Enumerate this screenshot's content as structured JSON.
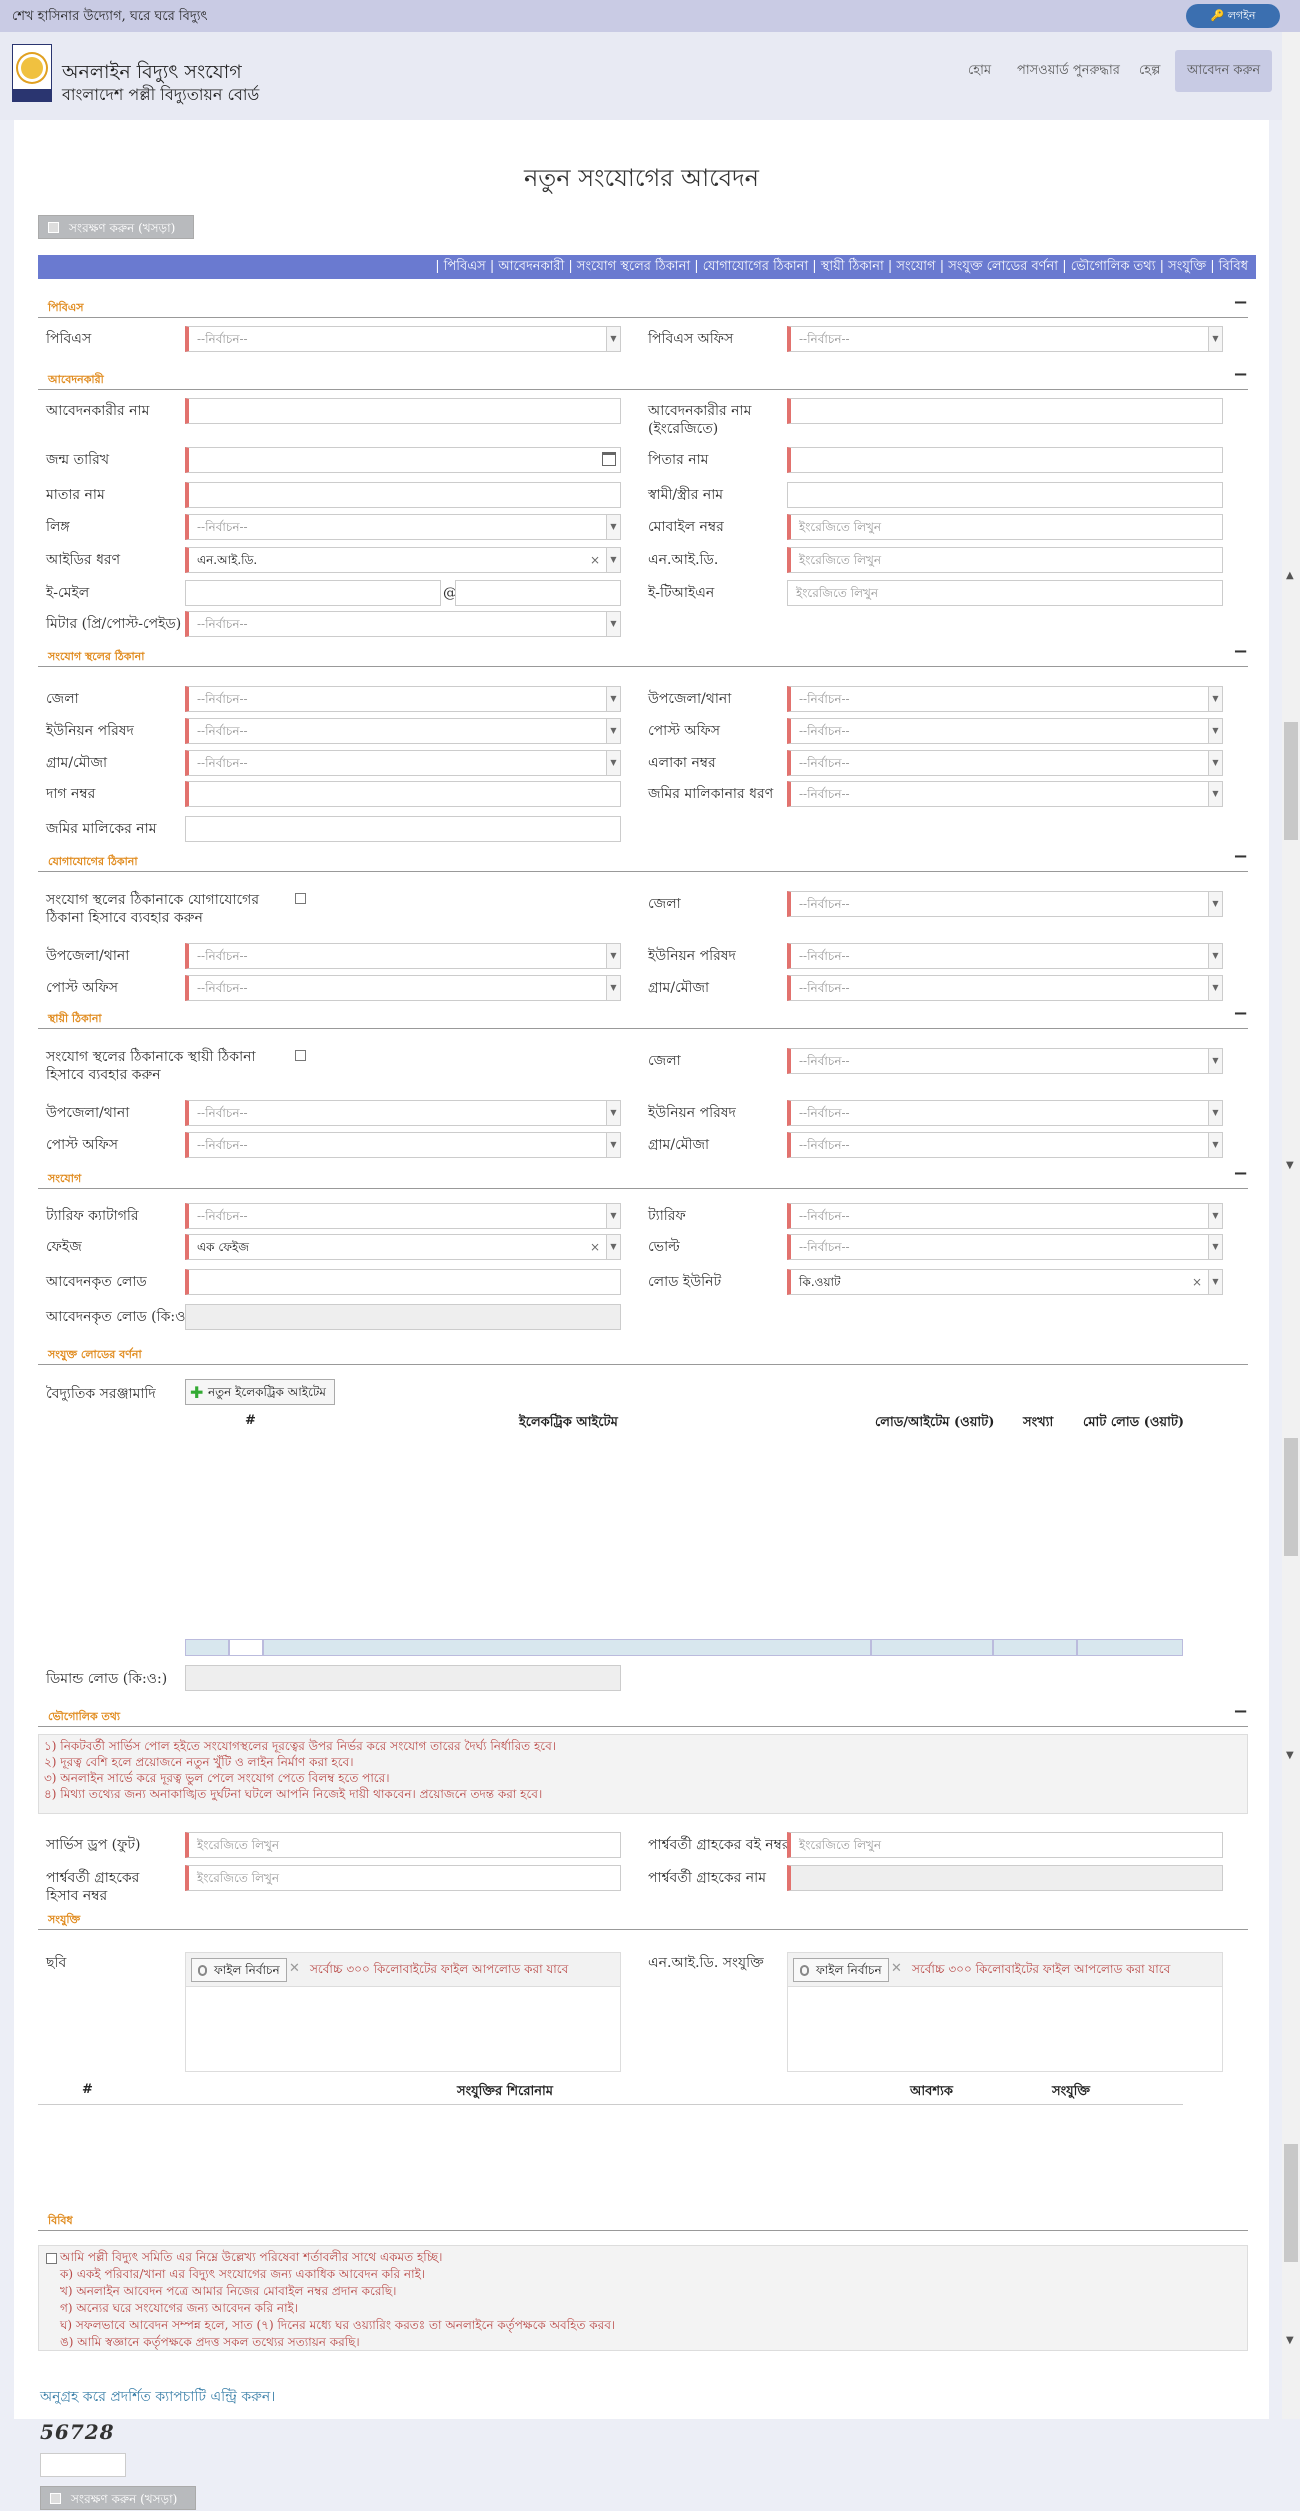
{
  "topbar": {
    "slogan": "শেখ হাসিনার উদ্যোগ, ঘরে ঘরে বিদ্যুৎ",
    "login": "🔑 লগইন"
  },
  "header": {
    "title": "অনলাইন বিদ্যুৎ সংযোগ",
    "subtitle": "বাংলাদেশ পল্লী বিদ্যুতায়ন বোর্ড",
    "nav": [
      "হোম",
      "পাসওয়ার্ড পুনরুদ্ধার",
      "হেল্প",
      "আবেদন করুন"
    ]
  },
  "page": {
    "title": "নতুন সংযোগের আবেদন",
    "save_label": "সংরক্ষণ করুন (খসড়া)",
    "tabs": "| পিবিএস | আবেদনকারী | সংযোগ স্থলের ঠিকানা | যোগাযোগের ঠিকানা | স্থায়ী ঠিকানা | সংযোগ | সংযুক্ত লোডের বর্ণনা | ভৌগোলিক তথ্য | সংযুক্তি | বিবিধ"
  },
  "placeholders": {
    "select": "--নির্বাচন--",
    "english": "ইংরেজিতে লিখুন"
  },
  "sections": {
    "pbs": {
      "title": "পিবিএস",
      "pbs": "পিবিএস",
      "office": "পিবিএস অফিস"
    },
    "applicant": {
      "title": "আবেদনকারী",
      "name": "আবেদনকারীর নাম",
      "name_en": "আবেদনকারীর নাম (ইংরেজিতে)",
      "dob": "জন্ম তারিখ",
      "father": "পিতার নাম",
      "mother": "মাতার নাম",
      "spouse": "স্বামী/স্ত্রীর নাম",
      "gender": "লিঙ্গ",
      "mobile": "মোবাইল নম্বর",
      "id_type": "আইডির ধরণ",
      "id_type_value": "এন.আই.ডি.",
      "nid": "এন.আই.ডি.",
      "email": "ই-মেইল",
      "email_at": "@",
      "tin": "ই-টিআইএন",
      "meter": "মিটার (প্রি/পোস্ট-পেইড)"
    },
    "conn_addr": {
      "title": "সংযোগ স্থলের ঠিকানা",
      "district": "জেলা",
      "upazila": "উপজেলা/থানা",
      "union": "ইউনিয়ন পরিষদ",
      "post": "পোস্ট অফিস",
      "village": "গ্রাম/মৌজা",
      "area": "এলাকা নম্বর",
      "dag": "দাগ নম্বর",
      "ownership": "জমির মালিকানার ধরণ",
      "owner": "জমির মালিকের নাম"
    },
    "contact_addr": {
      "title": "যোগাযোগের ঠিকানা",
      "same": "সংযোগ স্থলের ঠিকানাকে যোগাযোগের ঠিকানা হিসাবে ব্যবহার করুন",
      "district": "জেলা",
      "upazila": "উপজেলা/থানা",
      "union": "ইউনিয়ন পরিষদ",
      "post": "পোস্ট অফিস",
      "village": "গ্রাম/মৌজা"
    },
    "perm_addr": {
      "title": "স্থায়ী ঠিকানা",
      "same": "সংযোগ স্থলের ঠিকানাকে স্থায়ী ঠিকানা হিসাবে ব্যবহার করুন",
      "district": "জেলা",
      "upazila": "উপজেলা/থানা",
      "union": "ইউনিয়ন পরিষদ",
      "post": "পোস্ট অফিস",
      "village": "গ্রাম/মৌজা"
    },
    "connection": {
      "title": "সংযোগ",
      "tariff_cat": "ট্যারিফ ক্যাটাগরি",
      "tariff": "ট্যারিফ",
      "phase": "ফেইজ",
      "phase_value": "এক ফেইজ",
      "volt": "ভোল্ট",
      "load": "আবেদনকৃত লোড",
      "load_unit": "লোড ইউনিট",
      "load_unit_value": "কি.ওয়াট",
      "load_kw": "আবেদনকৃত লোড (কি:ও:)"
    },
    "load_desc": {
      "title": "সংযুক্ত লোডের বর্ণনা",
      "equipment": "বৈদ্যুতিক সরঞ্জামাদি",
      "add_item": "নতুন ইলেকট্রিক আইটেম",
      "columns": [
        "#",
        "ইলেকট্রিক আইটেম",
        "লোড/আইটেম (ওয়াট)",
        "সংখ্যা",
        "মোট লোড (ওয়াট)"
      ],
      "demand": "ডিমান্ড লোড (কি:ও:)"
    },
    "geo": {
      "title": "ভৌগোলিক তথ্য",
      "notes": [
        "১) নিকটবর্তী সার্ভিস পোল হইতে সংযোগস্থলের দূরত্বের উপর নির্ভর করে সংযোগ তারের দৈর্ঘ্য নির্ধারিত হবে।",
        "২) দূরত্ব বেশি হলে প্রয়োজনে নতুন খুঁটি ও লাইন নির্মাণ করা হবে।",
        "৩) অনলাইন সার্ভে করে দূরত্ব ভুল পেলে সংযোগ পেতে বিলম্ব হতে পারে।",
        "৪) মিথ্যা তথ্যের জন্য অনাকাঙ্খিত দুর্ঘটনা ঘটলে আপনি নিজেই দায়ী থাকবেন। প্রয়োজনে তদন্ত করা হবে।"
      ],
      "service_drop": "সার্ভিস ড্রপ (ফুট)",
      "neighbor_book": "পার্শ্ববর্তী গ্রাহকের বই নম্বর",
      "neighbor_acc": "পার্শ্ববর্তী গ্রাহকের হিসাব নম্বর",
      "neighbor_name": "পার্শ্ববর্তী গ্রাহকের নাম"
    },
    "attach": {
      "title": "সংযুক্তি",
      "photo": "ছবি",
      "nid": "এন.আই.ডি. সংযুক্তি",
      "choose": "ফাইল নির্বাচন",
      "limit": "সর্বোচ্চ ৩০০ কিলোবাইটের ফাইল আপলোড করা যাবে",
      "columns": [
        "#",
        "সংযুক্তির শিরোনাম",
        "আবশ্যক",
        "সংযুক্তি"
      ]
    },
    "misc": {
      "title": "বিবিধ",
      "agree": "আমি পল্লী বিদ্যুৎ সমিতি এর নিম্নে উল্লেখ্য পরিষেবা শর্তাবলীর সাথে একমত হচ্ছি।",
      "terms": [
        "ক) একই পরিবার/খানা এর বিদ্যুৎ সংযোগের জন্য একাধিক আবেদন করি নাই।",
        "খ) অনলাইন আবেদন পত্রে আমার নিজের মোবাইল নম্বর প্রদান করেছি।",
        "গ) অন্যের ঘরে সংযোগের জন্য আবেদন করি নাই।",
        "ঘ) সফলভাবে আবেদন সম্পন্ন হলে, সাত (৭) দিনের মধ্যে ঘর ওয়্যারিং করতঃ তা অনলাইনে কর্তৃপক্ষকে অবহিত করব।",
        "ঙ) আমি স্বজ্ঞানে কর্তৃপক্ষকে প্রদত্ত সকল তথ্যের সত্যায়ন করছি।"
      ]
    }
  },
  "captcha": {
    "prompt": "অনুগ্রহ করে প্রদর্শিত ক্যাপচাটি এন্ট্রি করুন।",
    "code": "56728"
  }
}
